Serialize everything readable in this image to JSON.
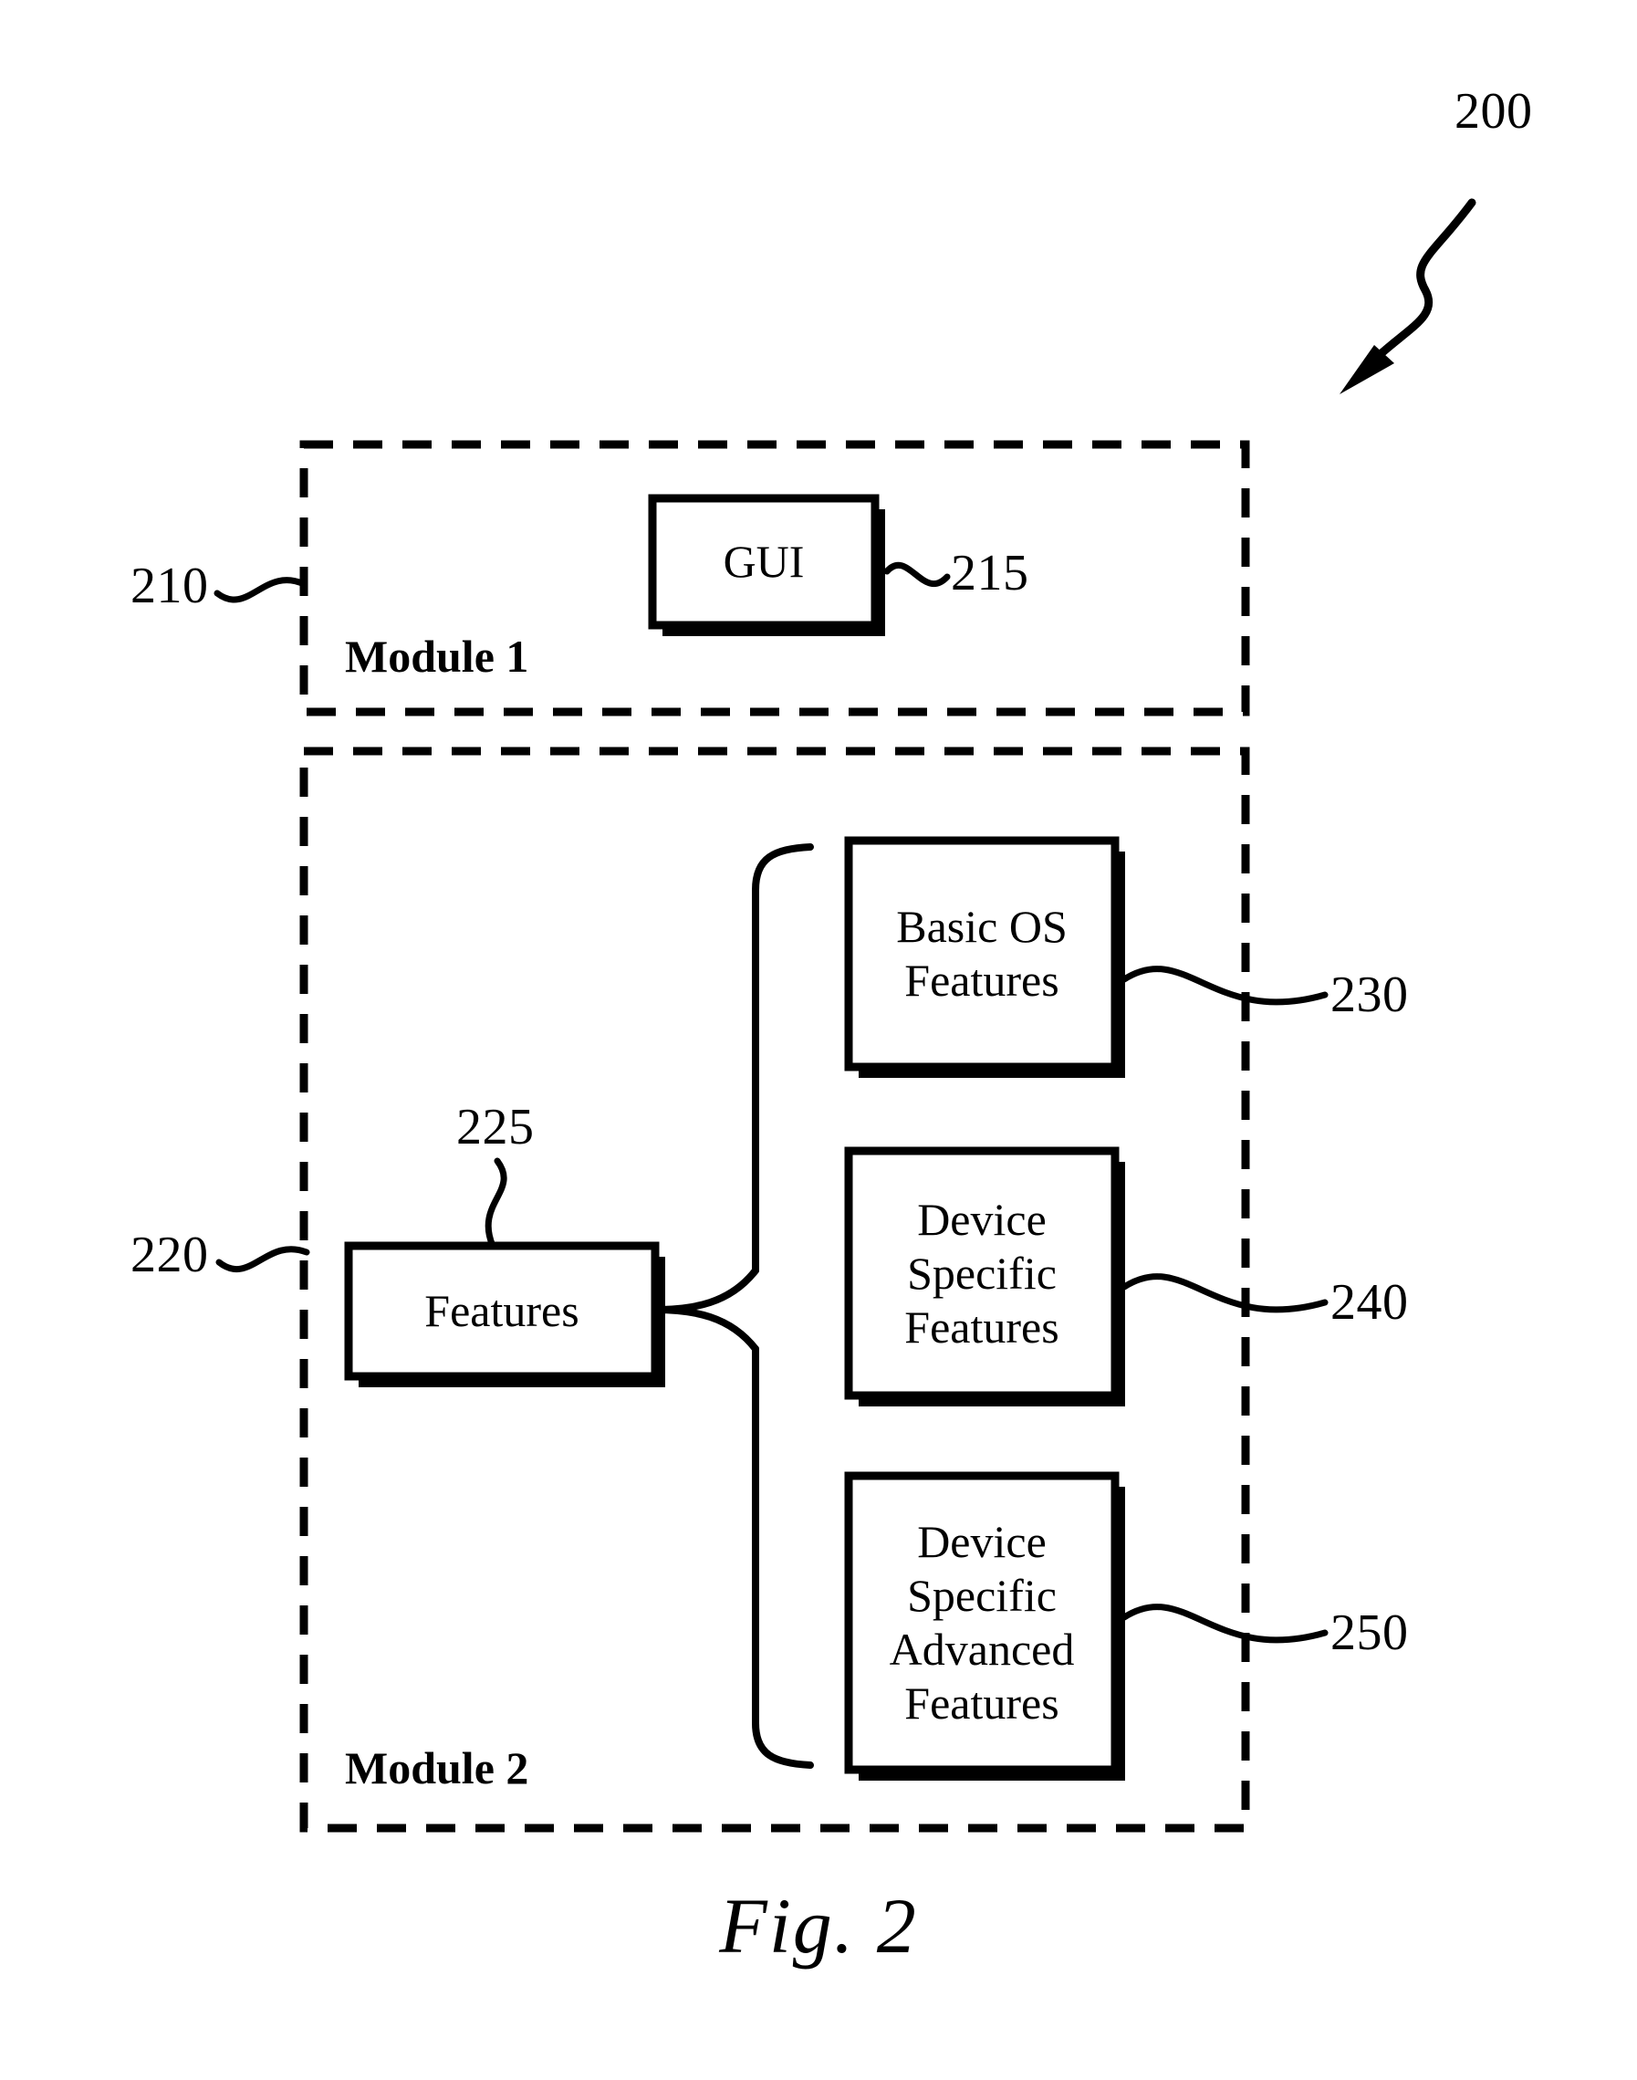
{
  "figure": {
    "caption": "Fig. 2",
    "overall_ref": "200"
  },
  "modules": [
    {
      "ref": "210",
      "name": "Module 1",
      "boxes": [
        {
          "ref": "215",
          "label": "GUI"
        }
      ]
    },
    {
      "ref": "220",
      "name": "Module 2",
      "boxes": [
        {
          "ref": "225",
          "label": "Features"
        },
        {
          "ref": "230",
          "label": "Basic OS\nFeatures"
        },
        {
          "ref": "240",
          "label": "Device\nSpecific\nFeatures"
        },
        {
          "ref": "250",
          "label": "Device\nSpecific\nAdvanced\nFeatures"
        }
      ]
    }
  ],
  "colors": {
    "ink": "#000000",
    "paper": "#ffffff"
  }
}
